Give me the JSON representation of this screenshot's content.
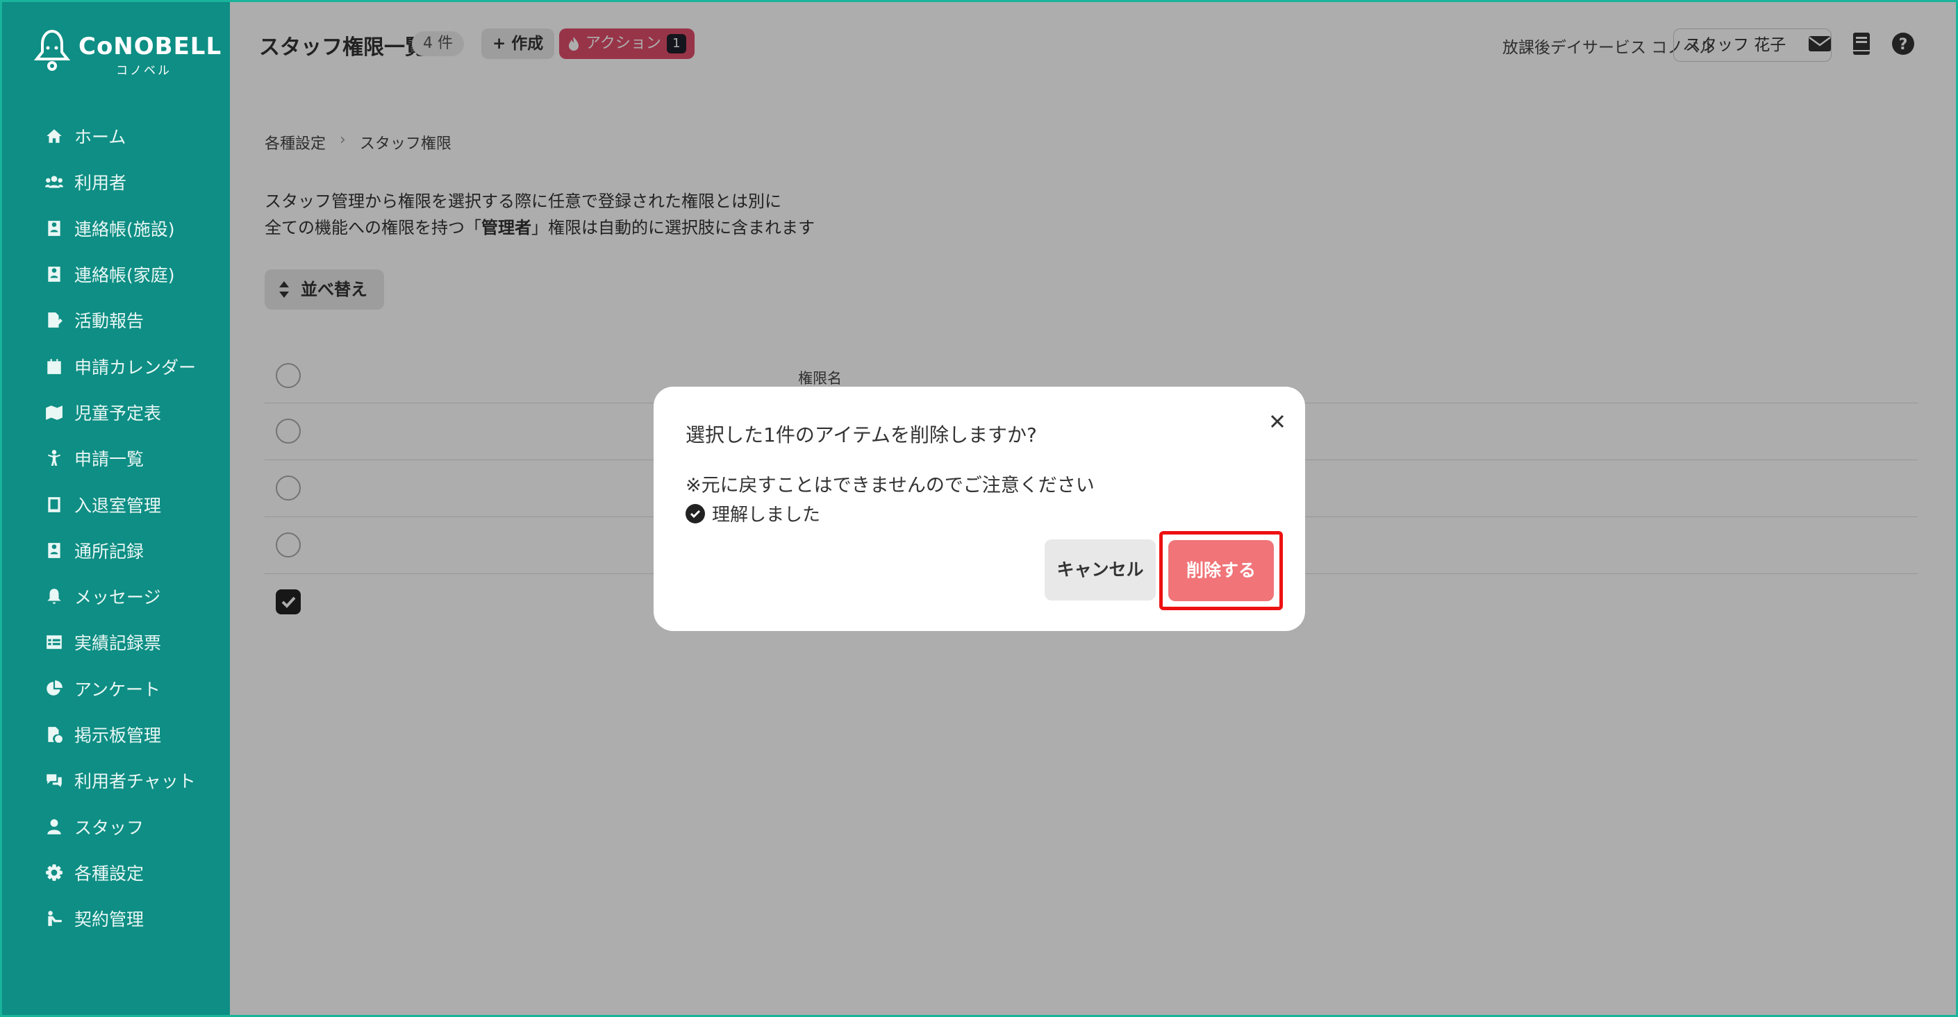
{
  "app": {
    "logo_text": "CoNOBELL",
    "logo_sub": "コノベル"
  },
  "sidebar": {
    "items": [
      {
        "label": "ホーム",
        "icon": "home-icon"
      },
      {
        "label": "利用者",
        "icon": "users-icon"
      },
      {
        "label": "連絡帳(施設)",
        "icon": "contact-book-icon"
      },
      {
        "label": "連絡帳(家庭)",
        "icon": "contact-book-icon"
      },
      {
        "label": "活動報告",
        "icon": "report-icon"
      },
      {
        "label": "申請カレンダー",
        "icon": "calendar-icon"
      },
      {
        "label": "児童予定表",
        "icon": "schedule-icon"
      },
      {
        "label": "申請一覧",
        "icon": "child-icon"
      },
      {
        "label": "入退室管理",
        "icon": "tablet-icon"
      },
      {
        "label": "通所記録",
        "icon": "record-icon"
      },
      {
        "label": "メッセージ",
        "icon": "bell-icon"
      },
      {
        "label": "実績記録票",
        "icon": "table-icon"
      },
      {
        "label": "アンケート",
        "icon": "pie-icon"
      },
      {
        "label": "掲示板管理",
        "icon": "board-icon"
      },
      {
        "label": "利用者チャット",
        "icon": "chat-icon"
      },
      {
        "label": "スタッフ",
        "icon": "staff-icon"
      },
      {
        "label": "各種設定",
        "icon": "gear-icon"
      },
      {
        "label": "契約管理",
        "icon": "contract-icon"
      }
    ]
  },
  "header": {
    "title": "スタッフ権限一覧",
    "count": "4 件",
    "create_label": "+ 作成",
    "action_label": "アクション",
    "action_count": "1",
    "org_name": "放課後デイサービス コノベル",
    "user_name": "スタッフ 花子"
  },
  "breadcrumb": {
    "parent": "各種設定",
    "current": "スタッフ権限"
  },
  "description": {
    "line1": "スタッフ管理から権限を選択する際に任意で登録された権限とは別に",
    "line2_pre": "全ての機能への権限を持つ「",
    "line2_bold": "管理者",
    "line2_post": "」権限は自動的に選択肢に含まれます"
  },
  "sort_label": "並べ替え",
  "table": {
    "column_header": "権限名",
    "rows": [
      {
        "checked": false
      },
      {
        "checked": false
      },
      {
        "checked": false
      },
      {
        "checked": true
      }
    ]
  },
  "modal": {
    "title": "選択した1件のアイテムを削除しますか?",
    "warning": "※元に戻すことはできませんのでご注意ください",
    "confirm_label": "理解しました",
    "cancel_label": "キャンセル",
    "delete_label": "削除する"
  },
  "colors": {
    "sidebar_bg": "#0e8e84",
    "action_badge": "#e04d6a",
    "delete_button": "#f07478",
    "highlight": "#ee1111"
  }
}
